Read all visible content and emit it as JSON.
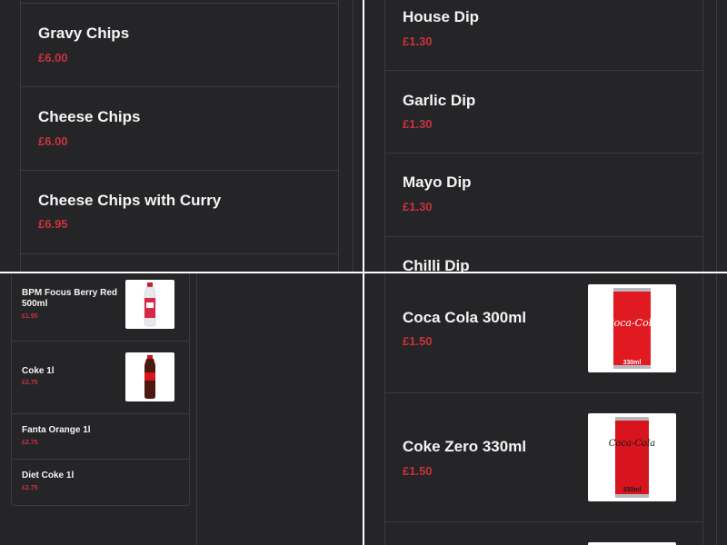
{
  "top_left": {
    "items": [
      {
        "name": "Gravy Chips",
        "price": "£6.00"
      },
      {
        "name": "Cheese Chips",
        "price": "£6.00"
      },
      {
        "name": "Cheese Chips with Curry",
        "price": "£6.95"
      }
    ]
  },
  "top_right": {
    "items": [
      {
        "name": "House Dip",
        "price": "£1.30"
      },
      {
        "name": "Garlic Dip",
        "price": "£1.30"
      },
      {
        "name": "Mayo Dip",
        "price": "£1.30"
      },
      {
        "name": "Chilli Dip"
      }
    ]
  },
  "bottom_left": {
    "items": [
      {
        "name": "BPM Focus Berry Red 500ml",
        "price": "£1.95",
        "image_icon": "bpm-bottle-icon"
      },
      {
        "name": "Coke 1l",
        "price": "£2.75",
        "image_icon": "coke-bottle-icon"
      },
      {
        "name": "Fanta Orange 1l",
        "price": "£2.75"
      },
      {
        "name": "Diet Coke 1l",
        "price": "£2.75"
      }
    ]
  },
  "bottom_right": {
    "items": [
      {
        "name": "Coca Cola 300ml",
        "price": "£1.50",
        "image_icon": "coca-cola-can-icon",
        "image_text": "Coca-Cola",
        "image_volume": "330ml"
      },
      {
        "name": "Coke Zero 330ml",
        "price": "£1.50",
        "image_icon": "coke-zero-can-icon",
        "image_text": "Coca-Cola",
        "image_volume": "330ml"
      }
    ]
  },
  "colors": {
    "background": "#252528",
    "price": "#c8323c",
    "divider": "#3a3a3e",
    "text": "#f4f4f4"
  }
}
